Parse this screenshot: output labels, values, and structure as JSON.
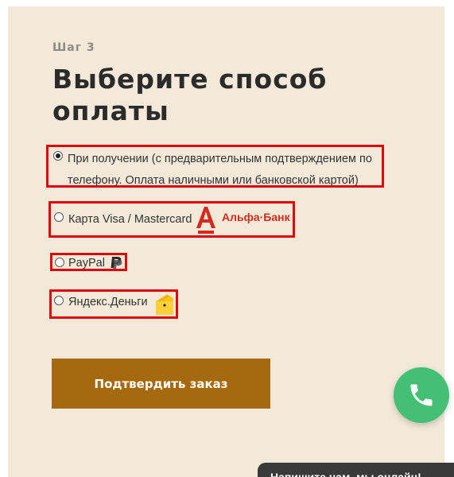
{
  "step_label": "Шаг 3",
  "title": "Выберите способ оплаты",
  "payment_options": [
    {
      "label": "При получении (с предварительным подтверждением по телефону. Оплата наличными или банковской картой)",
      "selected": true
    },
    {
      "label": "Карта Visa / Mastercard",
      "selected": false,
      "logo_text": "Альфа·Банк"
    },
    {
      "label": "PayPal",
      "selected": false
    },
    {
      "label": "Яндекс.Деньги",
      "selected": false
    }
  ],
  "confirm_button": "Подтвердить заказ",
  "chat_text": "Напишите нам, мы онлайн!",
  "colors": {
    "panel_bg": "#f2e9d9",
    "highlight_border": "#e00000",
    "confirm_bg": "#a5690f",
    "call_bg": "#43c074",
    "alfa_red": "#d42a1f"
  },
  "icons": [
    "radio-icon",
    "alfa-bank-logo",
    "paypal-icon",
    "yandex-money-icon",
    "phone-icon"
  ]
}
